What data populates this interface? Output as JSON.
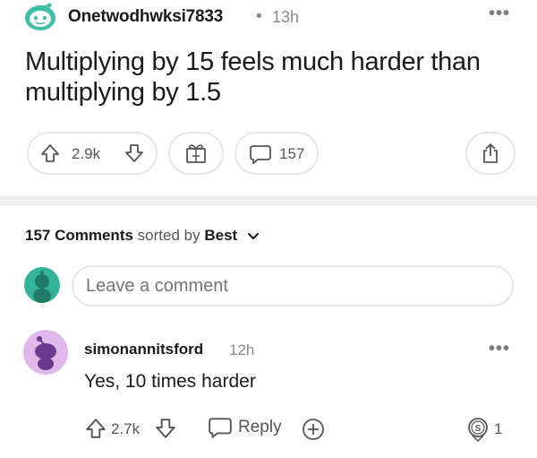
{
  "post": {
    "author": "Onetwodhwksi7833",
    "separator": "•",
    "time": "13h",
    "more": "•••",
    "title": "Multiplying by 15 feels much harder than multiplying by 1.5",
    "votes": "2.9k",
    "comments_count": "157"
  },
  "comments_section": {
    "count_label": "157 Comments",
    "sorted_by_text": "sorted by",
    "sort_value": "Best",
    "input_placeholder": "Leave a comment"
  },
  "comment": {
    "author": "simonannitsford",
    "time": "12h",
    "more": "•••",
    "body": "Yes, 10 times harder",
    "votes": "2.7k",
    "reply_label": "Reply",
    "silver_count": "1"
  },
  "icons": {
    "post_avatar": "snoo-avatar-icon",
    "upvote": "arrow-up-icon",
    "downvote": "arrow-down-icon",
    "award": "gift-icon",
    "comment": "speech-bubble-icon",
    "share": "share-icon",
    "sort": "chevron-down-icon",
    "user_avatar": "snoo-avatar-icon",
    "reply": "speech-bubble-icon",
    "silver": "silver-award-icon"
  },
  "colors": {
    "post_avatar": "#3fbfa6",
    "user_avatar": "#33b39a",
    "commenter_avatar_bg": "#e1b8ec",
    "commenter_avatar_fg": "#6b3a8f",
    "muted": "#878a8c",
    "border": "#e7e7e7",
    "divider": "#edeff1"
  }
}
